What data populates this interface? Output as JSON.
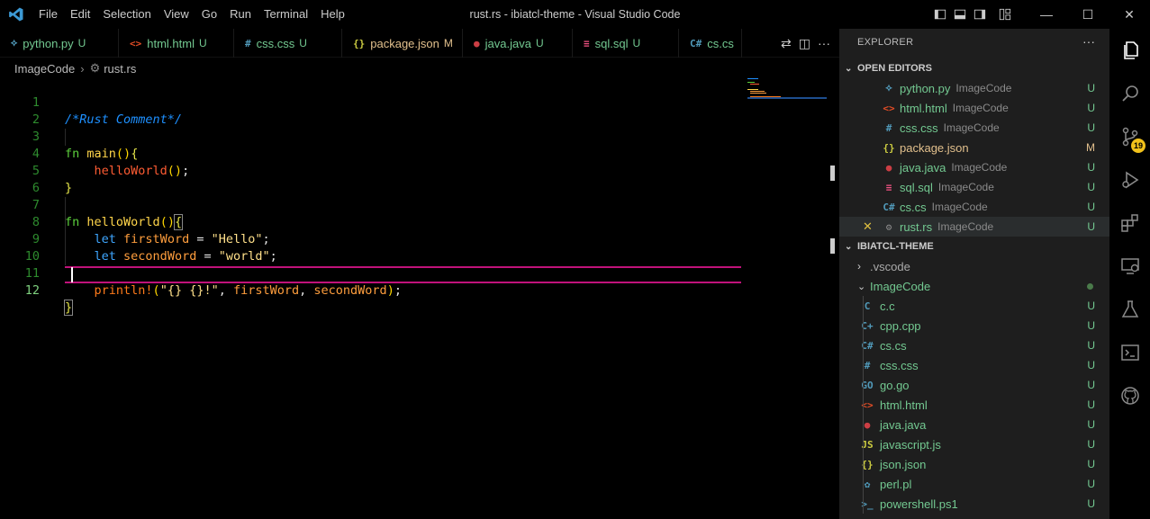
{
  "titlebar": {
    "menu": [
      "File",
      "Edit",
      "Selection",
      "View",
      "Go",
      "Run",
      "Terminal",
      "Help"
    ],
    "window_title": "rust.rs - ibiatcl-theme - Visual Studio Code",
    "min_glyph": "—",
    "max_glyph": "☐",
    "close_glyph": "✕"
  },
  "tabs": [
    {
      "icon": "⟡",
      "icon_color": "#519aba",
      "label": "python.py",
      "label_color": "#73c991",
      "status": "U",
      "status_color": "#73c991"
    },
    {
      "icon": "<>",
      "icon_color": "#e44d26",
      "label": "html.html",
      "label_color": "#73c991",
      "status": "U",
      "status_color": "#73c991"
    },
    {
      "icon": "#",
      "icon_color": "#519aba",
      "label": "css.css",
      "label_color": "#73c991",
      "status": "U",
      "status_color": "#73c991"
    },
    {
      "icon": "{}",
      "icon_color": "#cbcb41",
      "label": "package.json",
      "label_color": "#e2c08d",
      "status": "M",
      "status_color": "#e2c08d"
    },
    {
      "icon": "●",
      "icon_color": "#cc3e44",
      "label": "java.java",
      "label_color": "#73c991",
      "status": "U",
      "status_color": "#73c991"
    },
    {
      "icon": "≡",
      "icon_color": "#f55385",
      "label": "sql.sql",
      "label_color": "#73c991",
      "status": "U",
      "status_color": "#73c991"
    },
    {
      "icon": "C#",
      "icon_color": "#519aba",
      "label": "cs.cs",
      "label_color": "#73c991",
      "status": "",
      "status_color": "#73c991"
    }
  ],
  "tab_actions": {
    "compare": "⇄",
    "split": "◫",
    "more": "···"
  },
  "breadcrumb": {
    "folder": "ImageCode",
    "sep": "›",
    "file_icon": "⚙",
    "file": "rust.rs"
  },
  "editor": {
    "line_numbers": [
      "1",
      "2",
      "3",
      "4",
      "5",
      "6",
      "7",
      "8",
      "9",
      "10",
      "11",
      "12"
    ],
    "code": {
      "l1": "/*Rust Comment*/",
      "l3_kw": "fn",
      "l3_name": "main",
      "l3_paren": "()",
      "l3_brace": "{",
      "l4_call": "helloWorld",
      "l4_paren": "()",
      "l4_semi": ";",
      "l5_brace": "}",
      "l7_kw": "fn",
      "l7_name": "helloWorld",
      "l7_paren": "()",
      "l7_brace": "{",
      "l8_let": "let",
      "l8_var": "firstWord",
      "l8_eq": " = ",
      "l8_str": "\"Hello\"",
      "l8_semi": ";",
      "l9_let": "let",
      "l9_var": "secondWord",
      "l9_eq": " = ",
      "l9_str": "\"world\"",
      "l9_semi": ";",
      "l11_macro": "println!",
      "l11_open": "(",
      "l11_str": "\"{} {}!\"",
      "l11_c1": ", ",
      "l11_a1": "firstWord",
      "l11_c2": ", ",
      "l11_a2": "secondWord",
      "l11_close": ")",
      "l11_semi": ";",
      "l12_brace": "}"
    }
  },
  "sidebar": {
    "title": "EXPLORER",
    "more": "···",
    "open_editors_label": "OPEN EDITORS",
    "open_editors": [
      {
        "icon": "⟡",
        "icon_color": "#519aba",
        "name": "python.py",
        "name_color": "#73c991",
        "desc": "ImageCode",
        "status": "U",
        "status_color": "#73c991"
      },
      {
        "icon": "<>",
        "icon_color": "#e44d26",
        "name": "html.html",
        "name_color": "#73c991",
        "desc": "ImageCode",
        "status": "U",
        "status_color": "#73c991"
      },
      {
        "icon": "#",
        "icon_color": "#519aba",
        "name": "css.css",
        "name_color": "#73c991",
        "desc": "ImageCode",
        "status": "U",
        "status_color": "#73c991"
      },
      {
        "icon": "{}",
        "icon_color": "#cbcb41",
        "name": "package.json",
        "name_color": "#e2c08d",
        "desc": "",
        "status": "M",
        "status_color": "#e2c08d"
      },
      {
        "icon": "●",
        "icon_color": "#cc3e44",
        "name": "java.java",
        "name_color": "#73c991",
        "desc": "ImageCode",
        "status": "U",
        "status_color": "#73c991"
      },
      {
        "icon": "≡",
        "icon_color": "#f55385",
        "name": "sql.sql",
        "name_color": "#73c991",
        "desc": "ImageCode",
        "status": "U",
        "status_color": "#73c991"
      },
      {
        "icon": "C#",
        "icon_color": "#519aba",
        "name": "cs.cs",
        "name_color": "#73c991",
        "desc": "ImageCode",
        "status": "U",
        "status_color": "#73c991"
      },
      {
        "icon": "⚙",
        "icon_color": "#8a8a8a",
        "name": "rust.rs",
        "name_color": "#73c991",
        "desc": "ImageCode",
        "status": "U",
        "status_color": "#73c991",
        "close": "✕"
      }
    ],
    "project_label": "IBIATCL-THEME",
    "folders": {
      "vscode": ".vscode",
      "imagecode": "ImageCode",
      "chev_closed": "›",
      "chev_open": "⌄"
    },
    "files": [
      {
        "icon": "C",
        "icon_color": "#519aba",
        "name": "c.c",
        "status": "U"
      },
      {
        "icon": "C+",
        "icon_color": "#519aba",
        "name": "cpp.cpp",
        "status": "U"
      },
      {
        "icon": "C#",
        "icon_color": "#519aba",
        "name": "cs.cs",
        "status": "U"
      },
      {
        "icon": "#",
        "icon_color": "#519aba",
        "name": "css.css",
        "status": "U"
      },
      {
        "icon": "GO",
        "icon_color": "#519aba",
        "name": "go.go",
        "status": "U"
      },
      {
        "icon": "<>",
        "icon_color": "#e44d26",
        "name": "html.html",
        "status": "U"
      },
      {
        "icon": "●",
        "icon_color": "#cc3e44",
        "name": "java.java",
        "status": "U"
      },
      {
        "icon": "JS",
        "icon_color": "#cbcb41",
        "name": "javascript.js",
        "status": "U"
      },
      {
        "icon": "{}",
        "icon_color": "#cbcb41",
        "name": "json.json",
        "status": "U"
      },
      {
        "icon": "✿",
        "icon_color": "#519aba",
        "name": "perl.pl",
        "status": "U"
      },
      {
        "icon": ">_",
        "icon_color": "#519aba",
        "name": "powershell.ps1",
        "status": "U"
      }
    ],
    "file_name_color": "#73c991"
  },
  "activity": {
    "scm_badge": "19"
  }
}
